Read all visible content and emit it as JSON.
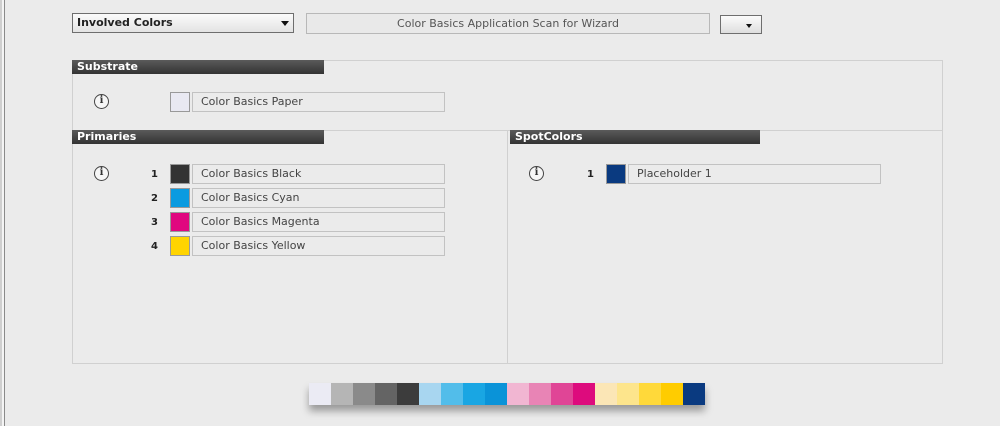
{
  "header": {
    "dropdown_label": "Involved Colors",
    "title_field": "Color Basics Application Scan for Wizard"
  },
  "substrate": {
    "heading": "Substrate",
    "swatch_color": "#e9e9f2",
    "name": "Color Basics Paper"
  },
  "primaries": {
    "heading": "Primaries",
    "items": [
      {
        "index": "1",
        "name": "Color Basics Black",
        "color": "#333333"
      },
      {
        "index": "2",
        "name": "Color Basics Cyan",
        "color": "#0a9be0"
      },
      {
        "index": "3",
        "name": "Color Basics Magenta",
        "color": "#e0077f"
      },
      {
        "index": "4",
        "name": "Color Basics Yellow",
        "color": "#ffd400"
      }
    ]
  },
  "spotcolors": {
    "heading": "SpotColors",
    "items": [
      {
        "index": "1",
        "name": "Placeholder 1",
        "color": "#0a3a80"
      }
    ]
  },
  "colorstrip": [
    "#ebebf4",
    "#b5b5b5",
    "#8a8a8a",
    "#646464",
    "#3c3c3c",
    "#a8d6f0",
    "#52bdea",
    "#19a6e3",
    "#0a93d8",
    "#f1b6d2",
    "#e884b5",
    "#e04596",
    "#dd0b7d",
    "#fbe6b6",
    "#fde58c",
    "#ffd93a",
    "#ffcc00",
    "#0a3a80"
  ]
}
